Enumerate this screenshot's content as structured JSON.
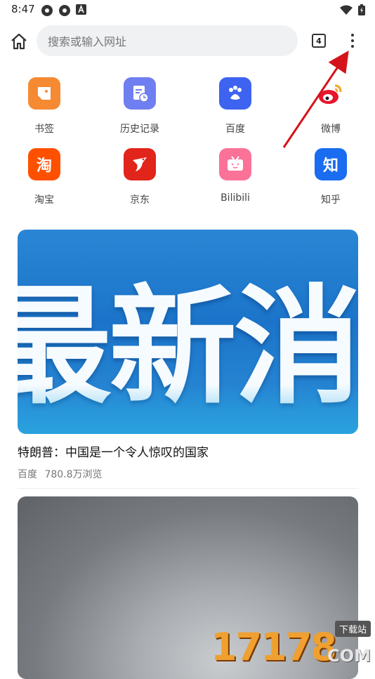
{
  "status_bar": {
    "time": "8:47"
  },
  "toolbar": {
    "search_placeholder": "搜索或输入网址",
    "tab_count": "4"
  },
  "shortcuts": [
    {
      "label": "书签",
      "icon": "bookmark-icon",
      "color": "#f58a33"
    },
    {
      "label": "历史记录",
      "icon": "history-icon",
      "color": "#6f7ef0"
    },
    {
      "label": "百度",
      "icon": "baidu-paw-icon",
      "color": "#3d63f0"
    },
    {
      "label": "微博",
      "icon": "weibo-icon",
      "color": "#e6162d"
    },
    {
      "label": "淘宝",
      "icon": "taobao-icon",
      "color": "#ff5000",
      "glyph": "淘"
    },
    {
      "label": "京东",
      "icon": "jd-icon",
      "color": "#e1251b"
    },
    {
      "label": "Bilibili",
      "icon": "bilibili-tv-icon",
      "color": "#fb7299"
    },
    {
      "label": "知乎",
      "icon": "zhihu-icon",
      "color": "#1a6cf0",
      "glyph": "知"
    }
  ],
  "feed": {
    "card1": {
      "image_text": "最新消息",
      "headline": "特朗普：中国是一个令人惊叹的国家",
      "source": "百度",
      "views": "780.8万浏览"
    }
  },
  "watermark": {
    "digits": "17178",
    "tag": "下载站",
    "domain": "COM"
  }
}
